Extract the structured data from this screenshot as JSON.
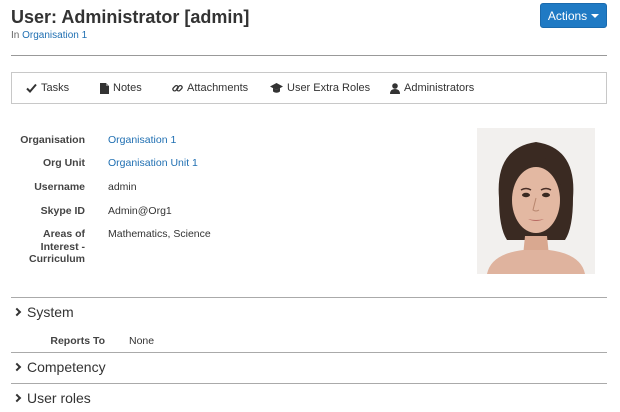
{
  "header": {
    "title": "User: Administrator [admin]",
    "in_prefix": "In",
    "in_link": "Organisation 1",
    "actions_label": "Actions"
  },
  "tabs": [
    {
      "label": "Tasks",
      "icon": "check-icon"
    },
    {
      "label": "Notes",
      "icon": "file-icon"
    },
    {
      "label": "Attachments",
      "icon": "link-icon"
    },
    {
      "label": "User Extra Roles",
      "icon": "graduation-cap-icon"
    },
    {
      "label": "Administrators",
      "icon": "user-icon"
    }
  ],
  "details": [
    {
      "label": "Organisation",
      "value": "Organisation 1",
      "link": true
    },
    {
      "label": "Org Unit",
      "value": "Organisation Unit 1",
      "link": true
    },
    {
      "label": "Username",
      "value": "admin",
      "link": false
    },
    {
      "label": "Skype ID",
      "value": "Admin@Org1",
      "link": false
    },
    {
      "label": "Areas of Interest - Curriculum",
      "value": "Mathematics, Science",
      "link": false
    }
  ],
  "sections": {
    "system": {
      "title": "System",
      "reports_to_label": "Reports To",
      "reports_to_value": "None"
    },
    "competency": {
      "title": "Competency"
    },
    "user_roles": {
      "title": "User roles"
    }
  },
  "colors": {
    "accent": "#1f7ac4",
    "link": "#1f6fb2"
  }
}
